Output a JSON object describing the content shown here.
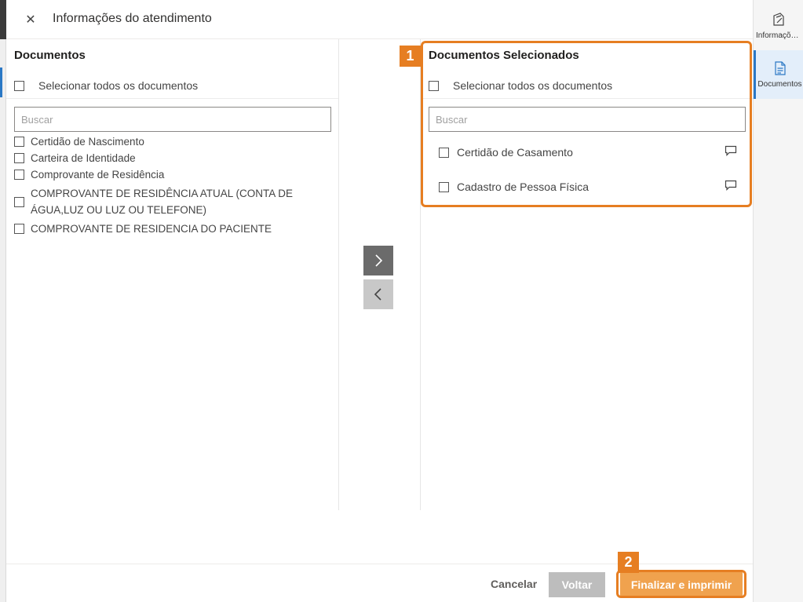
{
  "header": {
    "title": "Informações do atendimento",
    "close_glyph": "✕"
  },
  "left_panel": {
    "title": "Documentos",
    "select_all_label": "Selecionar todos os documentos",
    "search_placeholder": "Buscar",
    "items": [
      "Certidão de Nascimento",
      "Carteira de Identidade",
      "Comprovante de Residência",
      "COMPROVANTE DE RESIDÊNCIA ATUAL (CONTA DE ÁGUA,LUZ OU LUZ OU TELEFONE)",
      "COMPROVANTE DE RESIDENCIA DO PACIENTE"
    ]
  },
  "right_panel": {
    "title": "Documentos Selecionados",
    "select_all_label": "Selecionar todos os documentos",
    "search_placeholder": "Buscar",
    "items": [
      "Certidão de Casamento",
      "Cadastro de Pessoa Física"
    ]
  },
  "transfer": {
    "right_icon": "chevron-right-icon",
    "left_icon": "chevron-left-icon"
  },
  "footer": {
    "cancel_label": "Cancelar",
    "back_label": "Voltar",
    "finish_label": "Finalizar e imprimir"
  },
  "callouts": {
    "one": "1",
    "two": "2"
  },
  "side_rail": {
    "items": [
      {
        "label": "Informações do atendimento",
        "icon": "document-edit-icon"
      },
      {
        "label": "Documentos",
        "icon": "document-list-icon"
      }
    ]
  },
  "colors": {
    "accent_orange": "#e67e22",
    "finish_button": "#f0a24e",
    "selected_blue": "#2b78c5"
  }
}
